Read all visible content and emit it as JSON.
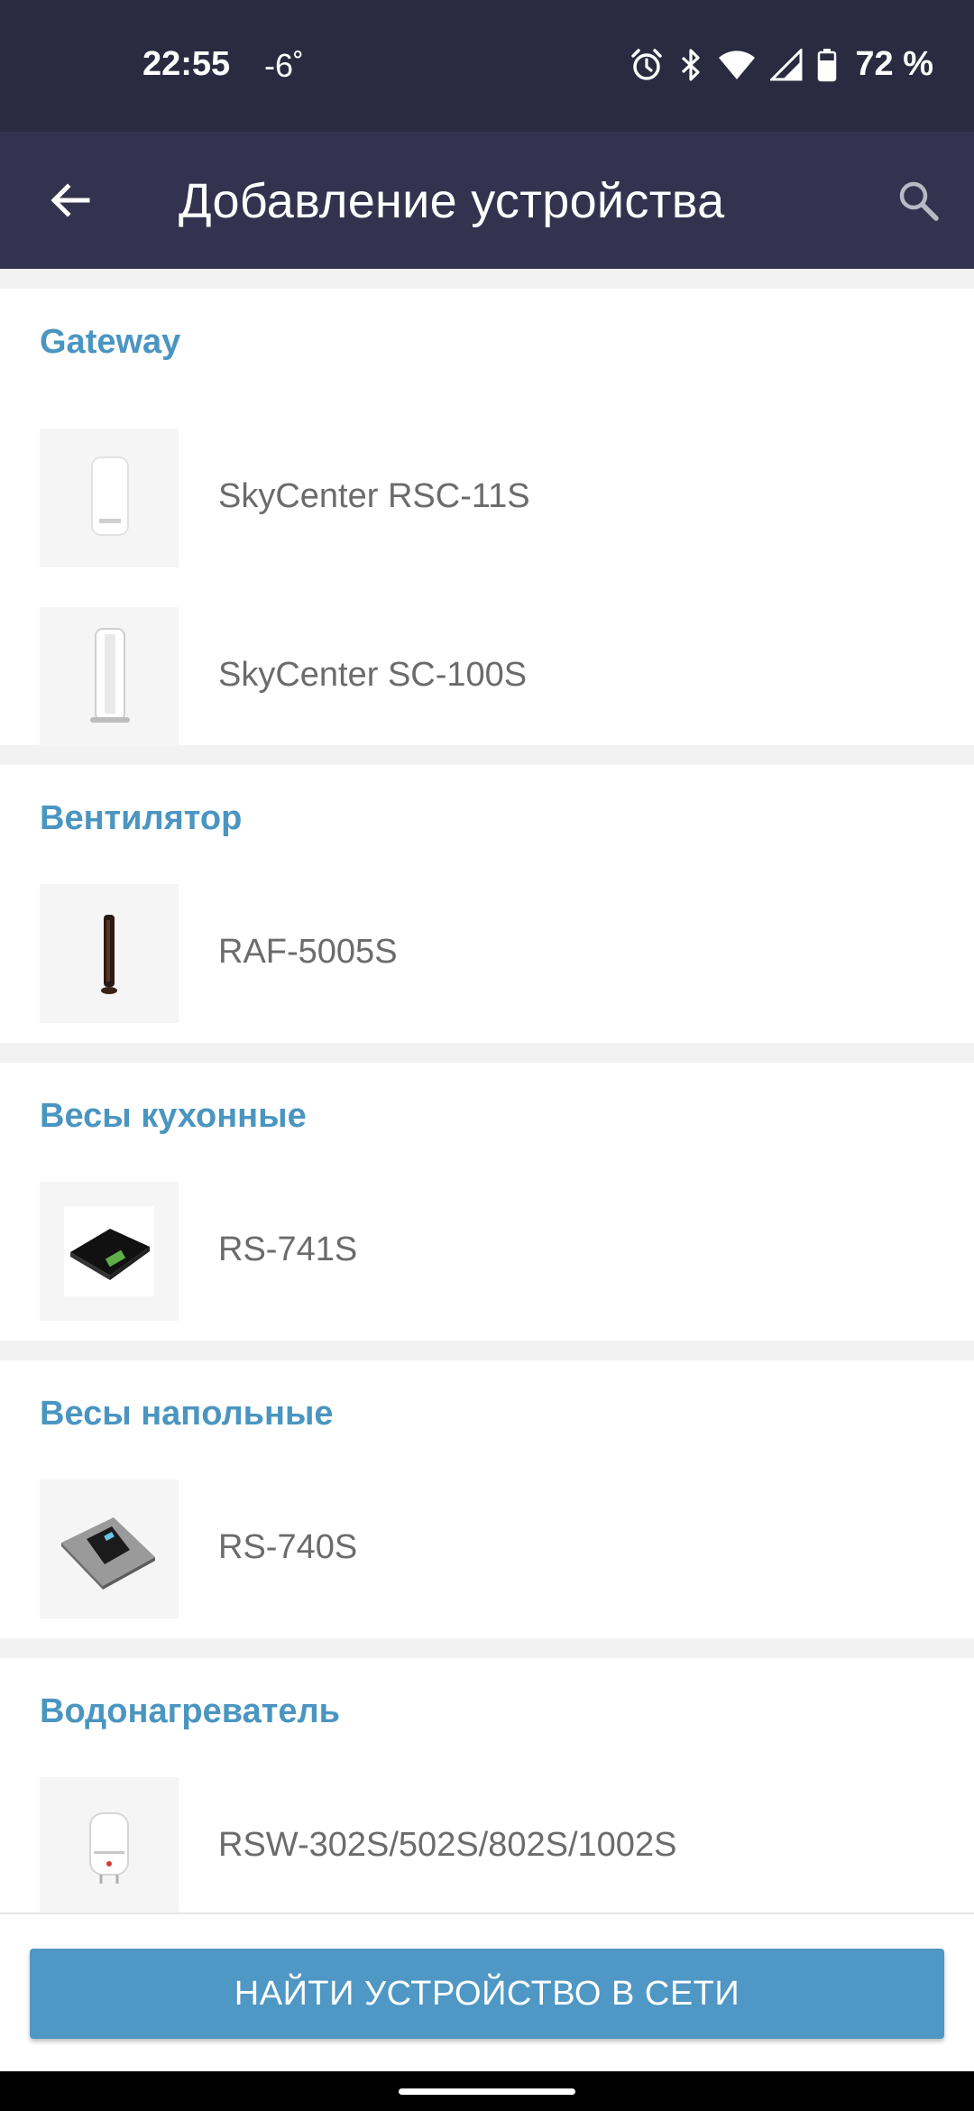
{
  "status_bar": {
    "time": "22:55",
    "temperature": "-6˚",
    "battery_percent": "72 %",
    "icons": [
      "alarm-icon",
      "bluetooth-icon",
      "wifi-icon",
      "signal-icon",
      "battery-icon"
    ]
  },
  "app_bar": {
    "title": "Добавление устройства",
    "back_icon": "arrow-back-icon",
    "search_icon": "search-icon"
  },
  "sections": [
    {
      "title": "Gateway",
      "devices": [
        {
          "name": "SkyCenter RSC-11S",
          "image": "white-hub-device"
        },
        {
          "name": "SkyCenter SC-100S",
          "image": "white-tall-hub-device"
        }
      ]
    },
    {
      "title": "Вентилятор",
      "devices": [
        {
          "name": "RAF-5005S",
          "image": "tower-fan"
        }
      ]
    },
    {
      "title": "Весы кухонные",
      "devices": [
        {
          "name": "RS-741S",
          "image": "kitchen-scale"
        }
      ]
    },
    {
      "title": "Весы напольные",
      "devices": [
        {
          "name": "RS-740S",
          "image": "floor-scale"
        }
      ]
    },
    {
      "title": "Водонагреватель",
      "devices": [
        {
          "name": "RSW-302S/502S/802S/1002S",
          "image": "water-heater"
        }
      ]
    }
  ],
  "bottom_button": {
    "label": "НАЙТИ УСТРОЙСТВО В СЕТИ"
  },
  "colors": {
    "status_bar_bg": "#2a2a40",
    "app_bar_bg": "#33334f",
    "section_title": "#4a95c1",
    "button_bg": "#4f97c4",
    "page_bg": "#f2f2f2"
  }
}
